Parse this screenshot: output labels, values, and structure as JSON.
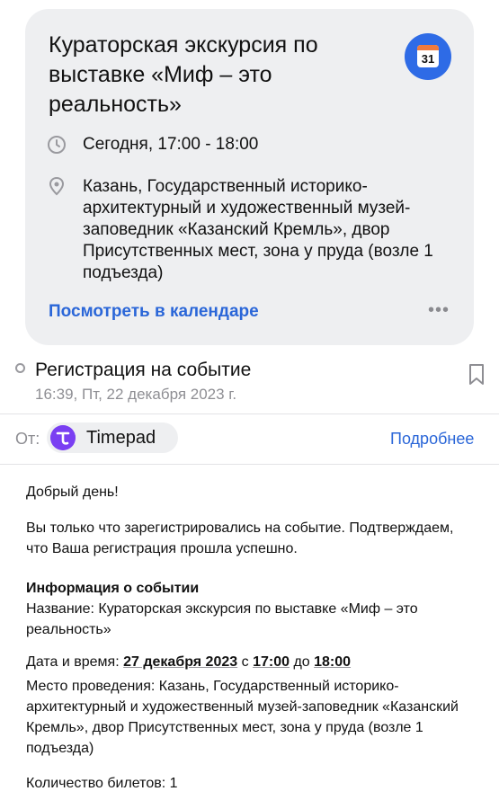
{
  "event_card": {
    "title": "Кураторская экскурсия по выставке «Миф – это реальность»",
    "calendar_icon_day": "31",
    "time": "Сегодня, 17:00 - 18:00",
    "place": "Казань, Государственный историко-архитектурный и художественный музей-заповедник «Казанский Кремль», двор Присутственных мест, зона у пруда (возле 1 подъезда)",
    "calendar_link": "Посмотреть в календаре",
    "more_label": "•••",
    "icons": [
      "clock-icon",
      "location-pin-icon",
      "calendar-icon",
      "more-icon"
    ],
    "colors": {
      "card_bg": "#eeeff1",
      "accent": "#2a66d8",
      "calendar_icon_bg": "#2e6be6",
      "calendar_top": "#f07a3c"
    }
  },
  "email": {
    "subject": "Регистрация на событие",
    "date": "16:39, Пт, 22 декабря 2023 г.",
    "from_label": "От:",
    "sender_name": "Timepad",
    "details_link": "Подробнее",
    "sender_logo_color": "#7a3ff2"
  },
  "body": {
    "greeting": "Добрый день!",
    "intro": "Вы только что зарегистрировались на событие. Подтверждаем, что Ваша регистрация прошла успешно.",
    "info_heading": "Информация о событии",
    "name_label": "Название:",
    "name_value": "Кураторская экскурсия по выставке «Миф – это реальность»",
    "datetime_label": "Дата и время:",
    "date_value": "27 декабря 2023",
    "from_word": "с",
    "start_time": "17:00",
    "to_word": "до",
    "end_time": "18:00",
    "venue_label": "Место проведения:",
    "venue_value": "Казань, Государственный историко-архитектурный и художественный музей-заповедник «Казанский Кремль», двор Присутственных мест, зона у пруда (возле 1 подъезда)",
    "tickets_label": "Количество билетов:",
    "tickets_value": "1"
  }
}
